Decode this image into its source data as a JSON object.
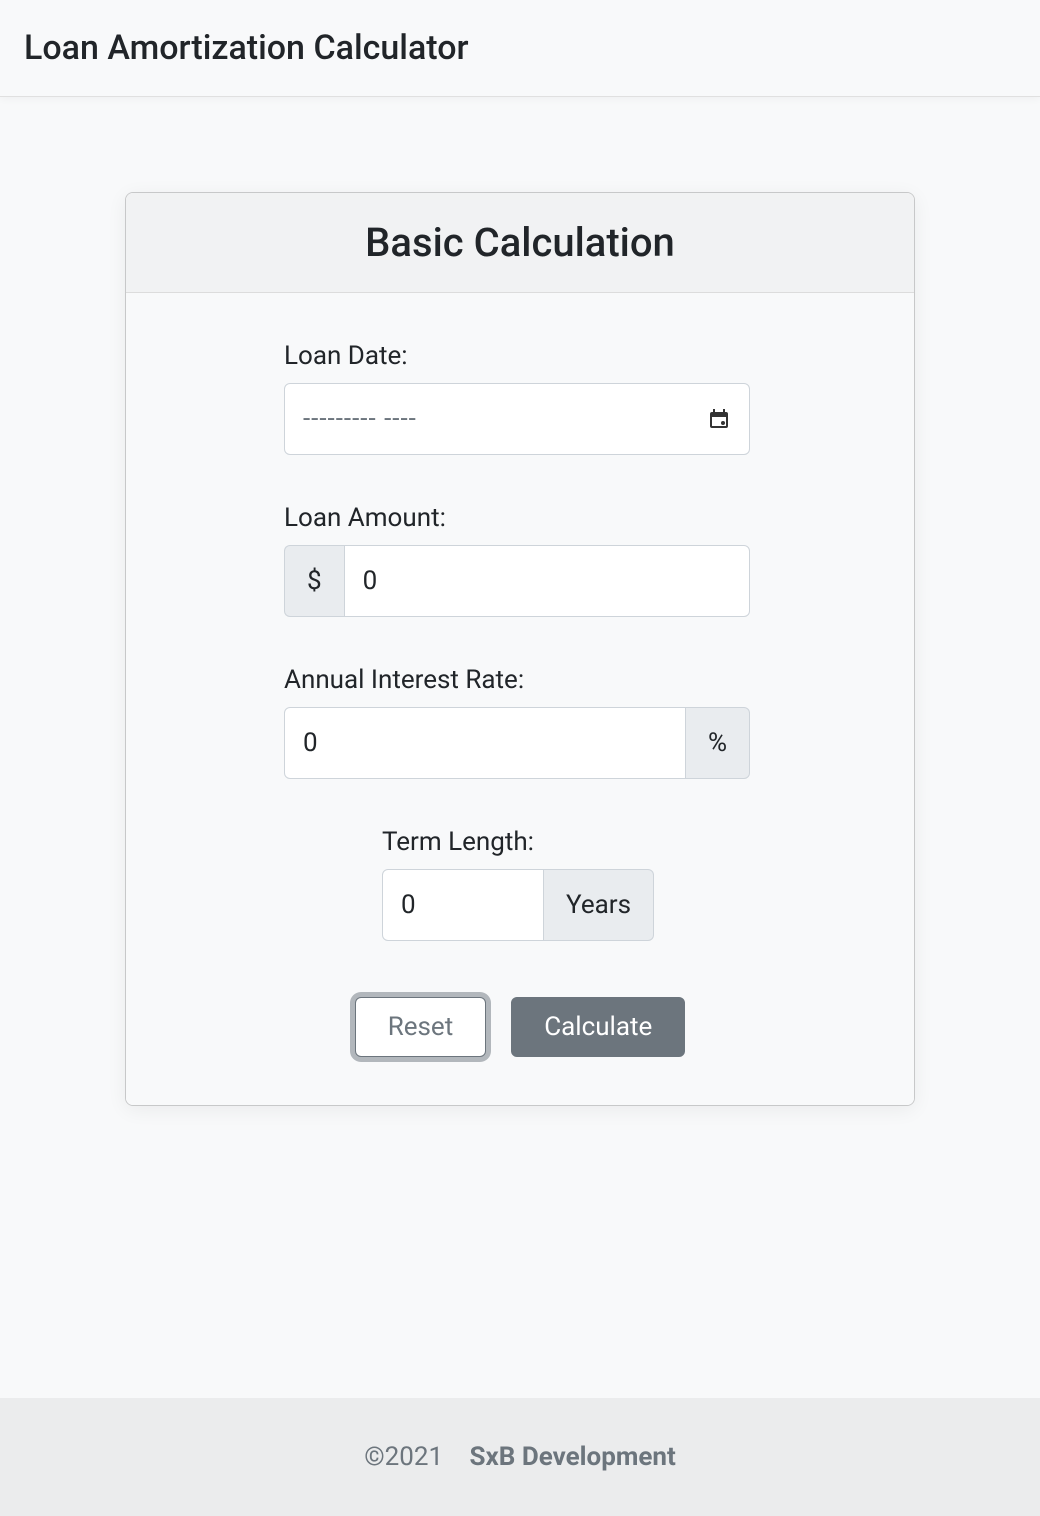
{
  "header": {
    "title": "Loan Amortization Calculator"
  },
  "card": {
    "title": "Basic Calculation"
  },
  "form": {
    "loan_date": {
      "label": "Loan Date:",
      "placeholder": "--------- ----"
    },
    "loan_amount": {
      "label": "Loan Amount:",
      "prefix": "$",
      "value": "0"
    },
    "interest_rate": {
      "label": "Annual Interest Rate:",
      "value": "0",
      "suffix": "%"
    },
    "term_length": {
      "label": "Term Length:",
      "value": "0",
      "suffix": "Years"
    },
    "buttons": {
      "reset": "Reset",
      "calculate": "Calculate"
    }
  },
  "footer": {
    "copyright": "©2021",
    "author": "SxB Development"
  }
}
